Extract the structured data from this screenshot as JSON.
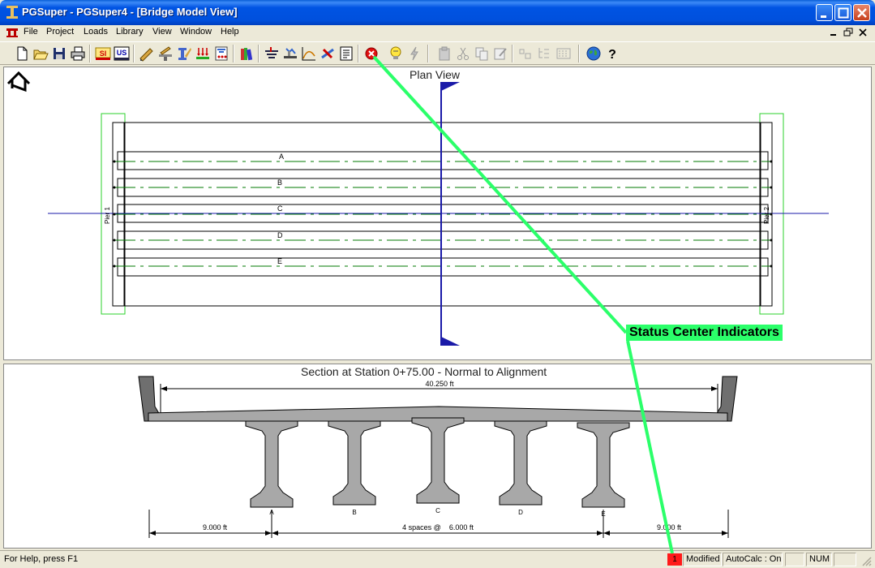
{
  "window": {
    "title": "PGSuper - PGSuper4 - [Bridge Model View]"
  },
  "menu": {
    "items": [
      "File",
      "Project",
      "Loads",
      "Library",
      "View",
      "Window",
      "Help"
    ]
  },
  "toolbar": {
    "unit_si": "SI",
    "unit_us": "US"
  },
  "plan_view": {
    "title": "Plan View",
    "girders": [
      "A",
      "B",
      "C",
      "D",
      "E"
    ],
    "pier_left": "Pier 1",
    "pier_right": "Pier 2"
  },
  "section_view": {
    "title": "Section at Station 0+75.00 - Normal to Alignment",
    "deck_width": "40.250 ft",
    "girders": [
      "A",
      "B",
      "C",
      "D",
      "E"
    ],
    "dim_left": "9.000 ft",
    "dim_middle": "4 spaces @    6.000 ft",
    "dim_right": "9.000 ft"
  },
  "annotation": {
    "label": "Status Center Indicators",
    "color": "#2bff6a"
  },
  "statusbar": {
    "help": "For Help, press F1",
    "status_center_count": "1",
    "modified": "Modified",
    "autocalc": "AutoCalc : On",
    "num": "NUM"
  },
  "colors": {
    "titlebar": "#0054e3",
    "girder_centerline": "#007a00",
    "section_cut": "#1a1aa8",
    "pier": "#2bd12b",
    "concrete": "#a8a8a8",
    "status_error": "#ff1a1a"
  }
}
